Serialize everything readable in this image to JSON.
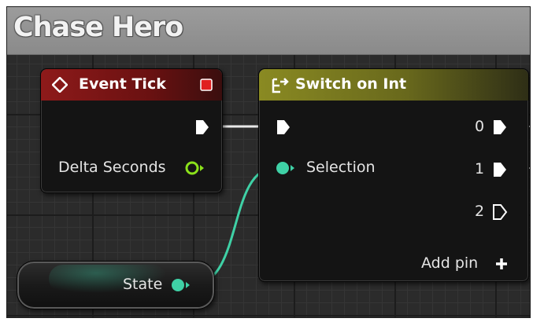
{
  "graph": {
    "title": "Chase Hero"
  },
  "colors": {
    "exec_wire": "#e8e8e8",
    "int_wire": "#3fd1a6",
    "float_pin": "#8be11b",
    "event_header": "#8e1a1a",
    "switch_header": "#8a8a22"
  },
  "nodes": {
    "event_tick": {
      "title": "Event Tick",
      "icon": "event-diamond-icon",
      "delegate_icon": "red-square-delegate-icon",
      "outputs": [
        {
          "name": "exec",
          "label": ""
        },
        {
          "name": "delta_seconds",
          "label": "Delta Seconds"
        }
      ]
    },
    "switch_on_int": {
      "title": "Switch on Int",
      "icon": "switch-icon",
      "inputs": [
        {
          "name": "exec",
          "label": ""
        },
        {
          "name": "selection",
          "label": "Selection"
        }
      ],
      "outputs": [
        "0",
        "1",
        "2"
      ],
      "add_pin_label": "Add pin"
    },
    "state_variable": {
      "label": "State"
    }
  }
}
